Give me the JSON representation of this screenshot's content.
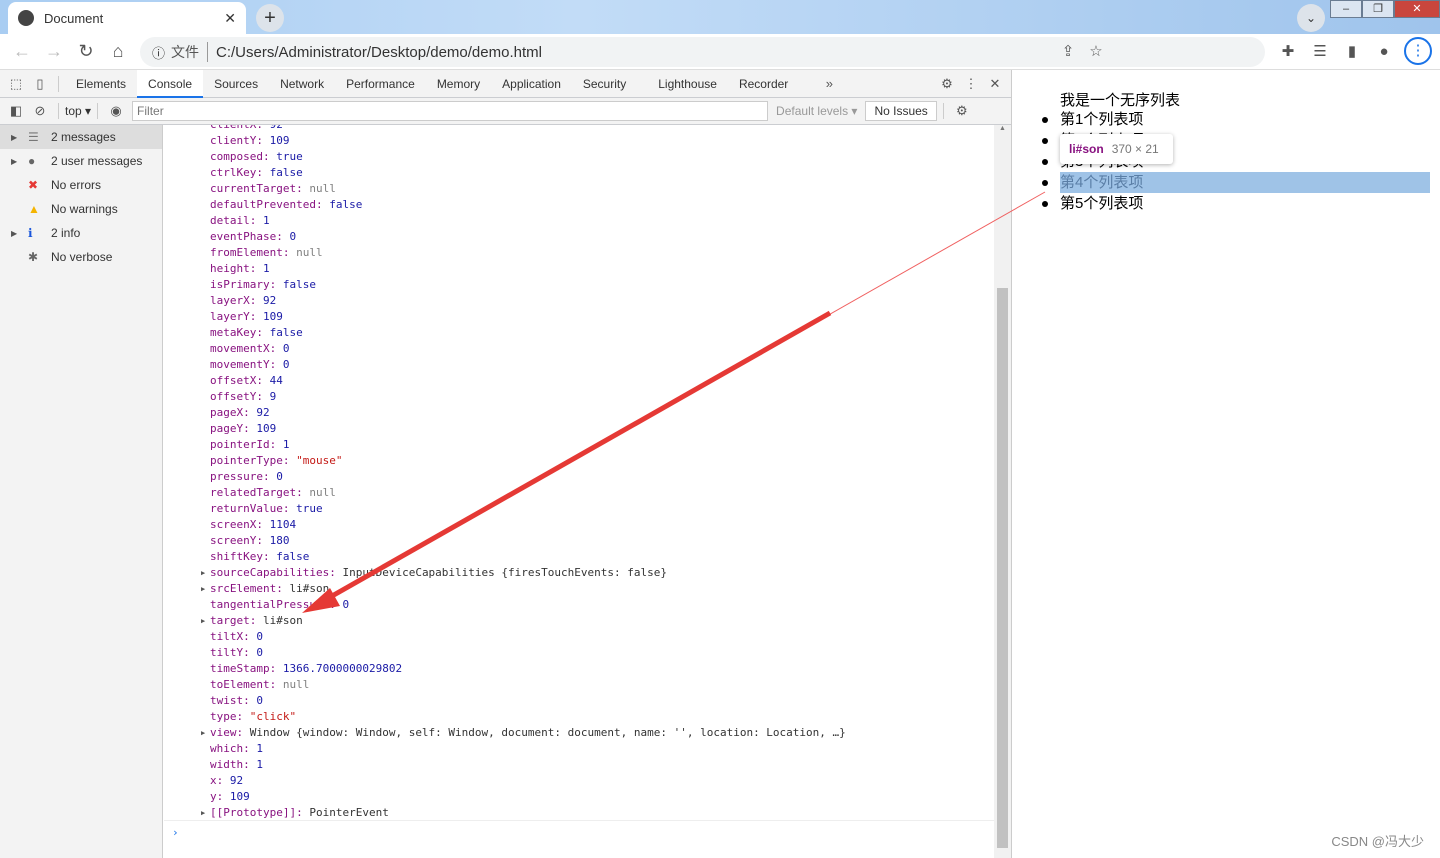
{
  "browser": {
    "tab_title": "Document",
    "new_tab": "+",
    "url_label": "文件",
    "url": "C:/Users/Administrator/Desktop/demo/demo.html"
  },
  "devtools": {
    "tabs": [
      "Elements",
      "Console",
      "Sources",
      "Network",
      "Performance",
      "Memory",
      "Application",
      "Security",
      "Lighthouse",
      "Recorder"
    ],
    "active_tab": "Console",
    "context": "top",
    "filter_placeholder": "Filter",
    "levels": "Default levels",
    "issues": "No Issues",
    "sidebar": [
      {
        "label": "2 messages",
        "icon": "list-icon",
        "expandable": true,
        "color": "#777"
      },
      {
        "label": "2 user messages",
        "icon": "user-icon",
        "expandable": true,
        "color": "#666"
      },
      {
        "label": "No errors",
        "icon": "error-icon",
        "expandable": false,
        "color": "#e53935"
      },
      {
        "label": "No warnings",
        "icon": "warning-icon",
        "expandable": false,
        "color": "#f4b400"
      },
      {
        "label": "2 info",
        "icon": "info-icon",
        "expandable": true,
        "color": "#1a56db"
      },
      {
        "label": "No verbose",
        "icon": "bug-icon",
        "expandable": false,
        "color": "#666"
      }
    ],
    "console_lines": [
      {
        "k": "clientX",
        "v": "92",
        "t": "num"
      },
      {
        "k": "clientY",
        "v": "109",
        "t": "num"
      },
      {
        "k": "composed",
        "v": "true",
        "t": "num"
      },
      {
        "k": "ctrlKey",
        "v": "false",
        "t": "num"
      },
      {
        "k": "currentTarget",
        "v": "null",
        "t": "nul"
      },
      {
        "k": "defaultPrevented",
        "v": "false",
        "t": "num"
      },
      {
        "k": "detail",
        "v": "1",
        "t": "num"
      },
      {
        "k": "eventPhase",
        "v": "0",
        "t": "num"
      },
      {
        "k": "fromElement",
        "v": "null",
        "t": "nul"
      },
      {
        "k": "height",
        "v": "1",
        "t": "num"
      },
      {
        "k": "isPrimary",
        "v": "false",
        "t": "num"
      },
      {
        "k": "layerX",
        "v": "92",
        "t": "num"
      },
      {
        "k": "layerY",
        "v": "109",
        "t": "num"
      },
      {
        "k": "metaKey",
        "v": "false",
        "t": "num"
      },
      {
        "k": "movementX",
        "v": "0",
        "t": "num"
      },
      {
        "k": "movementY",
        "v": "0",
        "t": "num"
      },
      {
        "k": "offsetX",
        "v": "44",
        "t": "num"
      },
      {
        "k": "offsetY",
        "v": "9",
        "t": "num"
      },
      {
        "k": "pageX",
        "v": "92",
        "t": "num"
      },
      {
        "k": "pageY",
        "v": "109",
        "t": "num"
      },
      {
        "k": "pointerId",
        "v": "1",
        "t": "num"
      },
      {
        "k": "pointerType",
        "v": "\"mouse\"",
        "t": "str"
      },
      {
        "k": "pressure",
        "v": "0",
        "t": "num"
      },
      {
        "k": "relatedTarget",
        "v": "null",
        "t": "nul"
      },
      {
        "k": "returnValue",
        "v": "true",
        "t": "num"
      },
      {
        "k": "screenX",
        "v": "1104",
        "t": "num"
      },
      {
        "k": "screenY",
        "v": "180",
        "t": "num"
      },
      {
        "k": "shiftKey",
        "v": "false",
        "t": "num"
      },
      {
        "k": "sourceCapabilities",
        "v": "InputDeviceCapabilities {firesTouchEvents: false}",
        "t": "obj",
        "x": true
      },
      {
        "k": "srcElement",
        "v": "li#son",
        "t": "obj",
        "x": true
      },
      {
        "k": "tangentialPressure",
        "v": "0",
        "t": "num"
      },
      {
        "k": "target",
        "v": "li#son",
        "t": "obj",
        "x": true
      },
      {
        "k": "tiltX",
        "v": "0",
        "t": "num"
      },
      {
        "k": "tiltY",
        "v": "0",
        "t": "num"
      },
      {
        "k": "timeStamp",
        "v": "1366.7000000029802",
        "t": "num"
      },
      {
        "k": "toElement",
        "v": "null",
        "t": "nul"
      },
      {
        "k": "twist",
        "v": "0",
        "t": "num"
      },
      {
        "k": "type",
        "v": "\"click\"",
        "t": "str"
      },
      {
        "k": "view",
        "v": "Window {window: Window, self: Window, document: document, name: '', location: Location, …}",
        "t": "obj",
        "x": true
      },
      {
        "k": "which",
        "v": "1",
        "t": "num"
      },
      {
        "k": "width",
        "v": "1",
        "t": "num"
      },
      {
        "k": "x",
        "v": "92",
        "t": "num"
      },
      {
        "k": "y",
        "v": "109",
        "t": "num"
      },
      {
        "k": "[[Prototype]]",
        "v": "PointerEvent",
        "t": "obj",
        "x": true
      }
    ]
  },
  "page": {
    "heading": "我是一个无序列表",
    "items": [
      "第1个列表项",
      "第2个列表项",
      "第3个列表项",
      "第4个列表项",
      "第5个列表项"
    ],
    "highlighted_index": 3,
    "tooltip": {
      "selector": "li#son",
      "size": "370 × 21"
    }
  },
  "watermark": "CSDN @冯大少",
  "colors": {
    "arrow": "#e53935",
    "highlight": "#9fc3e7",
    "accent": "#1a73e8"
  }
}
